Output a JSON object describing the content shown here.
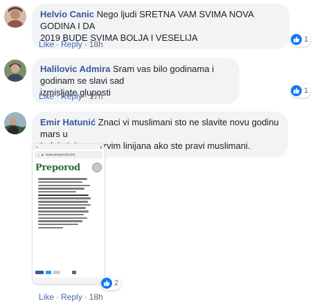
{
  "comments": [
    {
      "author": "Helvio Canic",
      "text_line1": " Nego ljudi SRETNA VAM SVIMA NOVA GODINA I DA",
      "text_line2": "2019 BUDE SVIMA BOLJA I VESELIJA",
      "like": "Like",
      "reply": "Reply",
      "time": "18h",
      "reactions": "1"
    },
    {
      "author": "Halilovic Admira",
      "text_line1": " Sram vas bilo godinama i godinam se slavi sad",
      "text_line2": "izmisljate gluposti",
      "like": "Like",
      "reply": "Reply",
      "time": "17h",
      "reactions": "1"
    },
    {
      "author": "Emir Hatunić",
      "text_line1": " Znaci vi muslimani sto ne slavite novu godinu mars u",
      "text_line2": "Irak i ginite na prvim linijana ako ste pravi muslimani.",
      "like": "Like",
      "reply": "Reply",
      "time": "18h",
      "reactions": "2"
    }
  ],
  "attachment": {
    "url": "www.preporod.com",
    "logo": "Preporod"
  },
  "separator": "·",
  "colors": {
    "author": "#385898",
    "link": "#4267b2",
    "bubble": "#f2f3f5",
    "like_badge": "#1877f2"
  }
}
